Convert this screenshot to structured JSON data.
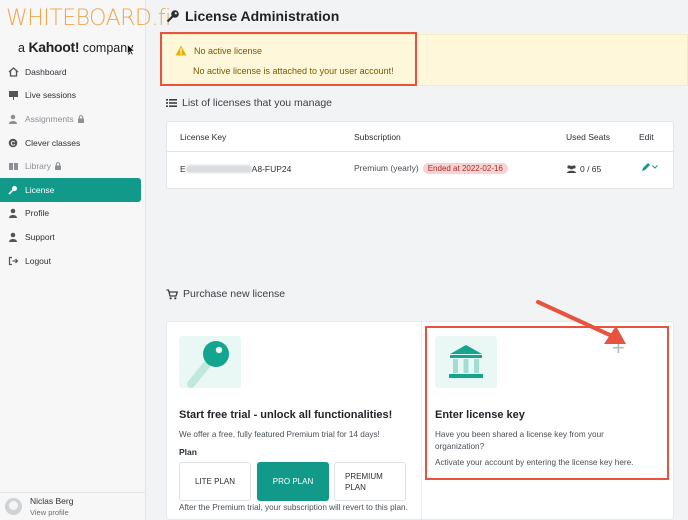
{
  "brand": {
    "name": "WHITEBOARD.fi",
    "sub_prefix": "a",
    "sub_brand": "Kahoot!",
    "sub_suffix": "company"
  },
  "sidebar": {
    "items": [
      {
        "label": "Dashboard",
        "icon": "house-icon"
      },
      {
        "label": "Live sessions",
        "icon": "whiteboard-icon"
      },
      {
        "label": "Assignments",
        "icon": "user-icon",
        "locked": true
      },
      {
        "label": "Clever classes",
        "icon": "clever-icon"
      },
      {
        "label": "Library",
        "icon": "book-icon",
        "locked": true
      },
      {
        "label": "License",
        "icon": "key-icon",
        "active": true
      },
      {
        "label": "Profile",
        "icon": "user-icon"
      },
      {
        "label": "Support",
        "icon": "user-icon"
      },
      {
        "label": "Logout",
        "icon": "logout-icon"
      }
    ],
    "user": {
      "name": "Niclas Berg",
      "link": "View profile"
    }
  },
  "page": {
    "title": "License Administration"
  },
  "alert": {
    "title": "No active license",
    "message": "No active license is attached to your user account!"
  },
  "licenses": {
    "title": "List of licenses that you manage",
    "headers": {
      "key": "License Key",
      "subscription": "Subscription",
      "seats": "Used Seats",
      "edit": "Edit"
    },
    "rows": [
      {
        "key_prefix": "E",
        "key_suffix": "A8-FUP24",
        "subscription": "Premium (yearly)",
        "badge": "Ended at 2022-02-16",
        "seats": "0 / 65"
      }
    ]
  },
  "purchase": {
    "title": "Purchase new license",
    "trial": {
      "heading": "Start free trial - unlock all functionalities!",
      "text": "We offer a free, fully featured Premium trial for 14 days!",
      "plan_label": "Plan",
      "plans": [
        {
          "label": "LITE PLAN"
        },
        {
          "label": "PRO PLAN",
          "selected": true
        },
        {
          "label": "PREMIUM PLAN"
        }
      ],
      "note": "After the Premium trial, your subscription will revert to this plan."
    },
    "key": {
      "heading": "Enter license key",
      "text1": "Have you been shared a license key from your organization?",
      "text2": "Activate your account by entering the license key here.",
      "plus": "+"
    }
  },
  "colors": {
    "accent": "#11998a",
    "brand": "#f0a64a",
    "highlight": "#e8533f",
    "alert_bg": "#fff7da",
    "badge_bg": "#f8d3d3"
  }
}
